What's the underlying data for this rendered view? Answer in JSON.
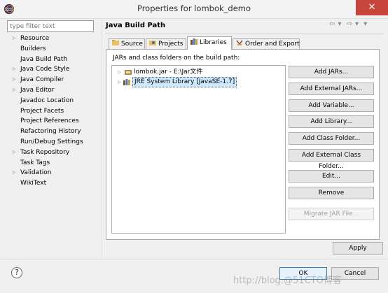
{
  "window": {
    "title": "Properties for lombok_demo",
    "close_glyph": "✕",
    "app_icon": "eclipse-icon"
  },
  "filter": {
    "placeholder": "type filter text"
  },
  "nav": {
    "items": [
      {
        "label": "Resource",
        "expandable": true
      },
      {
        "label": "Builders",
        "expandable": false
      },
      {
        "label": "Java Build Path",
        "expandable": false,
        "selected": true
      },
      {
        "label": "Java Code Style",
        "expandable": true
      },
      {
        "label": "Java Compiler",
        "expandable": true
      },
      {
        "label": "Java Editor",
        "expandable": true
      },
      {
        "label": "Javadoc Location",
        "expandable": false
      },
      {
        "label": "Project Facets",
        "expandable": false
      },
      {
        "label": "Project References",
        "expandable": false
      },
      {
        "label": "Refactoring History",
        "expandable": false
      },
      {
        "label": "Run/Debug Settings",
        "expandable": false
      },
      {
        "label": "Task Repository",
        "expandable": true
      },
      {
        "label": "Task Tags",
        "expandable": false
      },
      {
        "label": "Validation",
        "expandable": true
      },
      {
        "label": "WikiText",
        "expandable": false
      }
    ],
    "expand_glyph": "▷"
  },
  "header": {
    "title": "Java Build Path",
    "back_glyph": "⇦",
    "forward_glyph": "⇨",
    "dropdown_glyph": "▾"
  },
  "tabs": [
    {
      "label": "Source",
      "icon": "source-folder-icon",
      "active": false
    },
    {
      "label": "Projects",
      "icon": "projects-icon",
      "active": false
    },
    {
      "label": "Libraries",
      "icon": "libraries-icon",
      "active": true
    },
    {
      "label": "Order and Export",
      "icon": "order-export-icon",
      "active": false
    }
  ],
  "panel": {
    "description": "JARs and class folders on the build path:",
    "tree": [
      {
        "label": "lombok.jar - E:\\Jar文件",
        "icon": "jar-icon",
        "selected": false
      },
      {
        "label": "JRE System Library [JavaSE-1.7]",
        "icon": "library-icon",
        "selected": true
      }
    ],
    "buttons": [
      {
        "label": "Add JARs...",
        "enabled": true
      },
      {
        "label": "Add External JARs...",
        "enabled": true
      },
      {
        "label": "Add Variable...",
        "enabled": true
      },
      {
        "label": "Add Library...",
        "enabled": true
      },
      {
        "label": "Add Class Folder...",
        "enabled": true
      },
      {
        "label": "Add External Class Folder...",
        "enabled": true
      },
      {
        "label": "Edit...",
        "enabled": true
      },
      {
        "label": "Remove",
        "enabled": true
      },
      {
        "label": "Migrate JAR File...",
        "enabled": false
      }
    ]
  },
  "apply_label": "Apply",
  "footer": {
    "help_glyph": "?",
    "ok_label": "OK",
    "cancel_label": "Cancel"
  },
  "watermark": "http://blog.@51CTO博客",
  "colors": {
    "close_button": "#c7453b",
    "ok_border": "#3c7fb1",
    "selection": "#cde8ff"
  }
}
